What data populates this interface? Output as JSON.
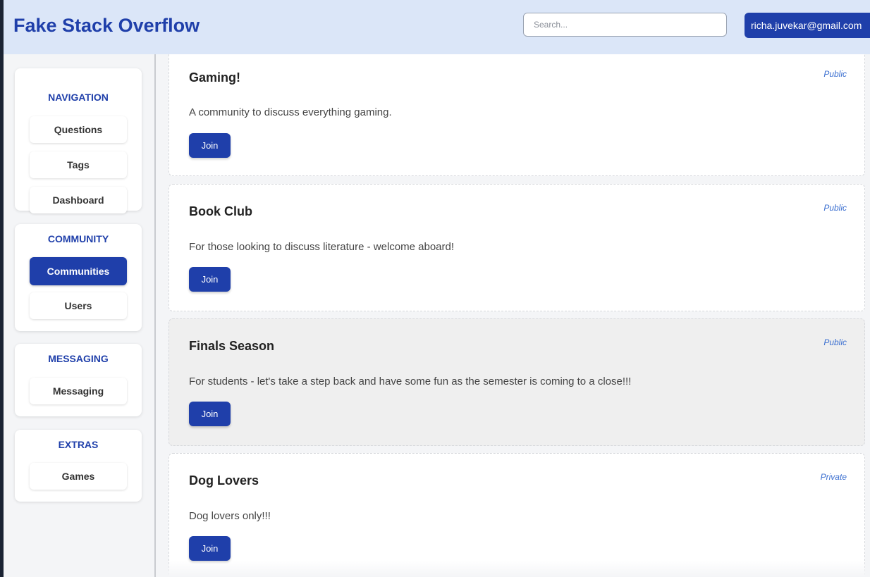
{
  "app": {
    "title": "Fake Stack Overflow",
    "search_placeholder": "Search...",
    "user_email": "richa.juvekar@gmail.com"
  },
  "sidebar": {
    "groups": [
      {
        "title": "NAVIGATION",
        "items": [
          {
            "label": "Questions",
            "active": false
          },
          {
            "label": "Tags",
            "active": false
          },
          {
            "label": "Dashboard",
            "active": false
          }
        ]
      },
      {
        "title": "COMMUNITY",
        "items": [
          {
            "label": "Communities",
            "active": true
          },
          {
            "label": "Users",
            "active": false
          }
        ]
      },
      {
        "title": "MESSAGING",
        "items": [
          {
            "label": "Messaging",
            "active": false
          }
        ]
      },
      {
        "title": "EXTRAS",
        "items": [
          {
            "label": "Games",
            "active": false
          }
        ]
      }
    ]
  },
  "communities": [
    {
      "name": "Gaming!",
      "visibility": "Public",
      "description": "A community to discuss everything gaming.",
      "action": "Join"
    },
    {
      "name": "Book Club",
      "visibility": "Public",
      "description": "For those looking to discuss literature - welcome aboard!",
      "action": "Join"
    },
    {
      "name": "Finals Season",
      "visibility": "Public",
      "description": "For students - let's take a step back and have some fun as the semester is coming to a close!!!",
      "action": "Join"
    },
    {
      "name": "Dog Lovers",
      "visibility": "Private",
      "description": "Dog lovers only!!!",
      "action": "Join"
    }
  ],
  "colors": {
    "brand": "#1f3faa",
    "header_bg": "#dbe6f8",
    "visibility_text": "#3b6fd0",
    "hovered_card_bg": "#efefef"
  }
}
